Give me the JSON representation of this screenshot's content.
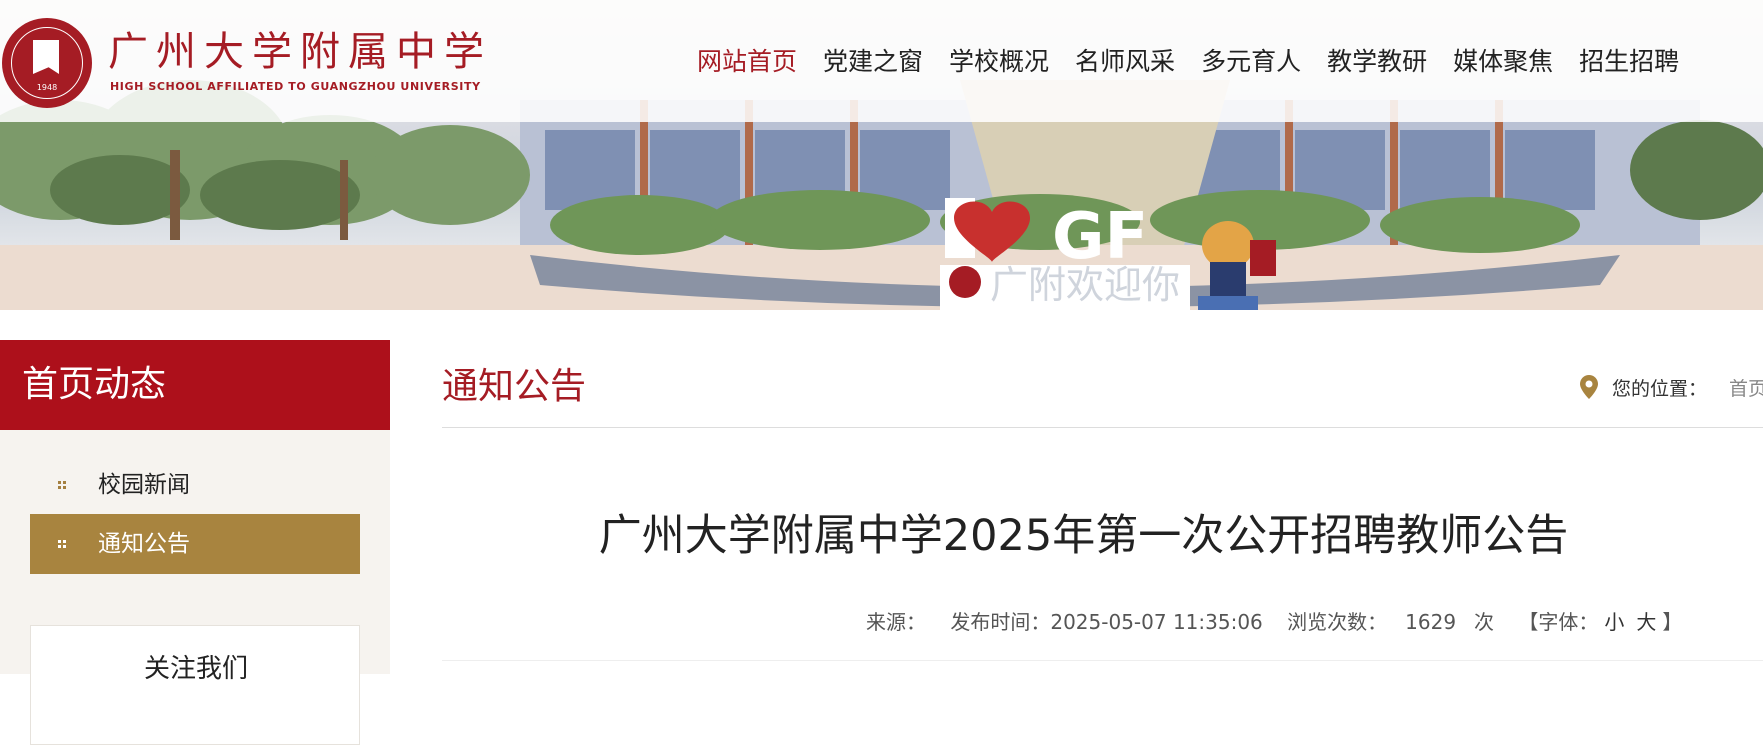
{
  "header": {
    "site_name": "广州大学附属中学",
    "site_subtitle": "HIGH SCHOOL AFFILIATED TO GUANGZHOU UNIVERSITY",
    "logo_year": "1948",
    "nav": [
      {
        "label": "网站首页",
        "active": true
      },
      {
        "label": "党建之窗"
      },
      {
        "label": "学校概况"
      },
      {
        "label": "名师风采"
      },
      {
        "label": "多元育人"
      },
      {
        "label": "教学教研"
      },
      {
        "label": "媒体聚焦"
      },
      {
        "label": "招生招聘"
      }
    ]
  },
  "banner": {
    "slogan_letters_left": "I",
    "slogan_letters_right": "GF",
    "slogan_cn": "广附欢迎你"
  },
  "sidebar": {
    "title": "首页动态",
    "items": [
      {
        "label": "校园新闻",
        "active": false
      },
      {
        "label": "通知公告",
        "active": true
      }
    ],
    "follow_title": "关注我们"
  },
  "main": {
    "section_title": "通知公告",
    "breadcrumb_label": "您的位置：",
    "breadcrumb_home": "首页",
    "article": {
      "title": "广州大学附属中学2025年第一次公开招聘教师公告",
      "source_label": "来源：",
      "publish_label": "发布时间：2025-05-07 11:35:06",
      "views_label": "浏览次数：",
      "views_count": "1629",
      "views_unit": "次",
      "font_label": "【字体：",
      "font_small": "小",
      "font_large": "大",
      "font_close": "】"
    }
  },
  "colors": {
    "brand_red": "#a51c24",
    "sidebar_active": "#a8843f",
    "sidebar_head": "#ad101b"
  }
}
